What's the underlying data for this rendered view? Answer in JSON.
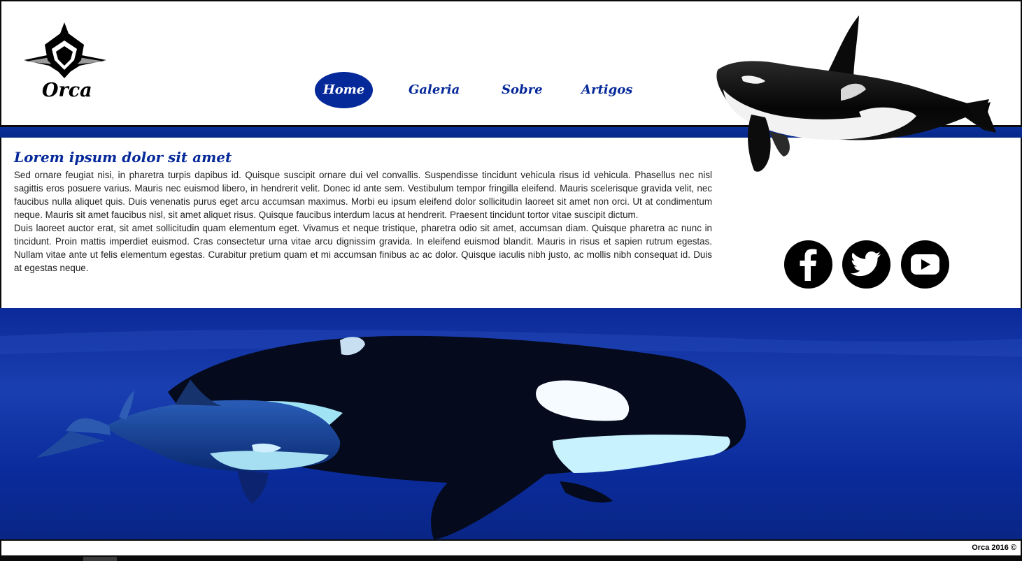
{
  "site": {
    "logo_text": "Orca"
  },
  "nav": {
    "items": [
      {
        "label": "Home",
        "active": true
      },
      {
        "label": "Galeria",
        "active": false
      },
      {
        "label": "Sobre",
        "active": false
      },
      {
        "label": "Artigos",
        "active": false
      }
    ]
  },
  "article": {
    "title": "Lorem ipsum dolor sit amet",
    "paragraphs": [
      "Sed ornare feugiat nisi, in pharetra turpis dapibus id. Quisque suscipit ornare dui vel convallis. Suspendisse tincidunt vehicula risus id vehicula. Phasellus nec nisl sagittis eros posuere varius. Mauris nec euismod libero, in hendrerit velit. Donec id ante sem. Vestibulum tempor fringilla eleifend. Mauris scelerisque gravida velit, nec faucibus nulla aliquet quis. Duis venenatis purus eget arcu accumsan maximus. Morbi eu ipsum eleifend dolor sollicitudin laoreet sit amet non orci. Ut at condimentum neque. Mauris sit amet faucibus nisl, sit amet aliquet risus. Quisque faucibus interdum lacus at hendrerit. Praesent tincidunt tortor vitae suscipit dictum.",
      "Duis laoreet auctor erat, sit amet sollicitudin quam elementum eget. Vivamus et neque tristique, pharetra odio sit amet, accumsan diam. Quisque pharetra ac nunc in tincidunt. Proin mattis imperdiet euismod. Cras consectetur urna vitae arcu dignissim gravida. In eleifend euismod blandit. Mauris in risus et sapien rutrum egestas. Nullam vitae ante ut felis elementum egestas. Curabitur pretium quam et mi accumsan finibus ac ac dolor. Quisque iaculis nibh justo, ac mollis nibh consequat id. Duis at egestas neque."
    ]
  },
  "social": {
    "icons": [
      "facebook-icon",
      "twitter-icon",
      "youtube-icon"
    ]
  },
  "footer": {
    "copyright": "Orca 2016 ©"
  },
  "colors": {
    "brand_blue": "#06299a",
    "black": "#000000",
    "white": "#ffffff"
  }
}
